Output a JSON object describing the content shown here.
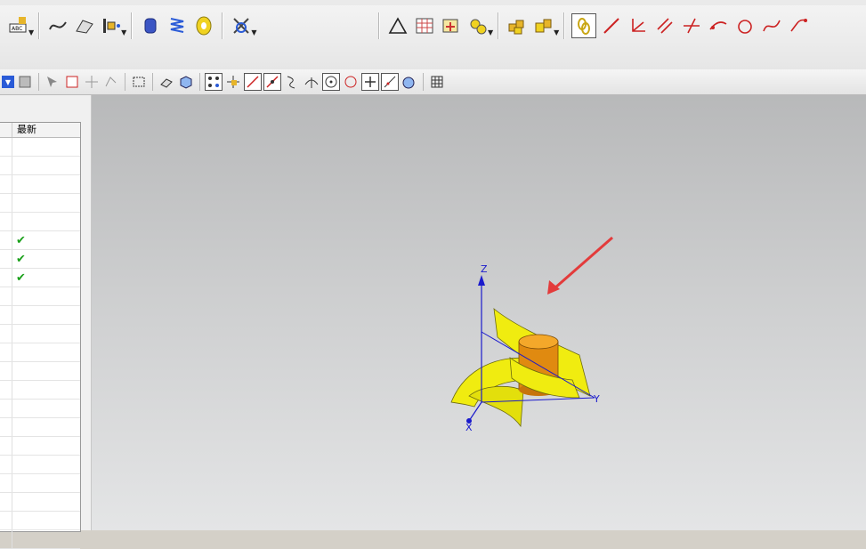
{
  "tree": {
    "column_header": "最新",
    "check_mark": "✔",
    "rows": [
      {
        "checked": false
      },
      {
        "checked": false
      },
      {
        "checked": false
      },
      {
        "checked": false
      },
      {
        "checked": false
      },
      {
        "checked": true
      },
      {
        "checked": true
      },
      {
        "checked": true
      },
      {
        "checked": false
      },
      {
        "checked": false
      },
      {
        "checked": false
      },
      {
        "checked": false
      },
      {
        "checked": false
      },
      {
        "checked": false
      },
      {
        "checked": false
      },
      {
        "checked": false
      },
      {
        "checked": false
      },
      {
        "checked": false
      },
      {
        "checked": false
      },
      {
        "checked": false
      },
      {
        "checked": false
      },
      {
        "checked": false
      }
    ]
  },
  "axes": {
    "z": "Z",
    "y": "Y",
    "x": "X"
  },
  "toolbar_top": {
    "icons": [
      "text-abc-icon",
      "sketch-curve-icon",
      "curve-icon",
      "point-set-icon",
      "cylinder-icon",
      "spring-icon",
      "washer-icon",
      "bolt-icon",
      "triangle-icon",
      "table-icon",
      "pattern-icon",
      "gear-icon",
      "assembly-icon",
      "assembly-2-icon",
      "link-icon",
      "line-icon",
      "axes-icon",
      "parallel-line-icon",
      "cross-line-icon",
      "arc-icon",
      "circle-icon",
      "spline-icon",
      "fillet-icon"
    ]
  },
  "colors": {
    "surface": "#f0ec10",
    "cylinder": "#e88a10",
    "axis": "#1a1acc",
    "arrow": "#e33b3b"
  }
}
